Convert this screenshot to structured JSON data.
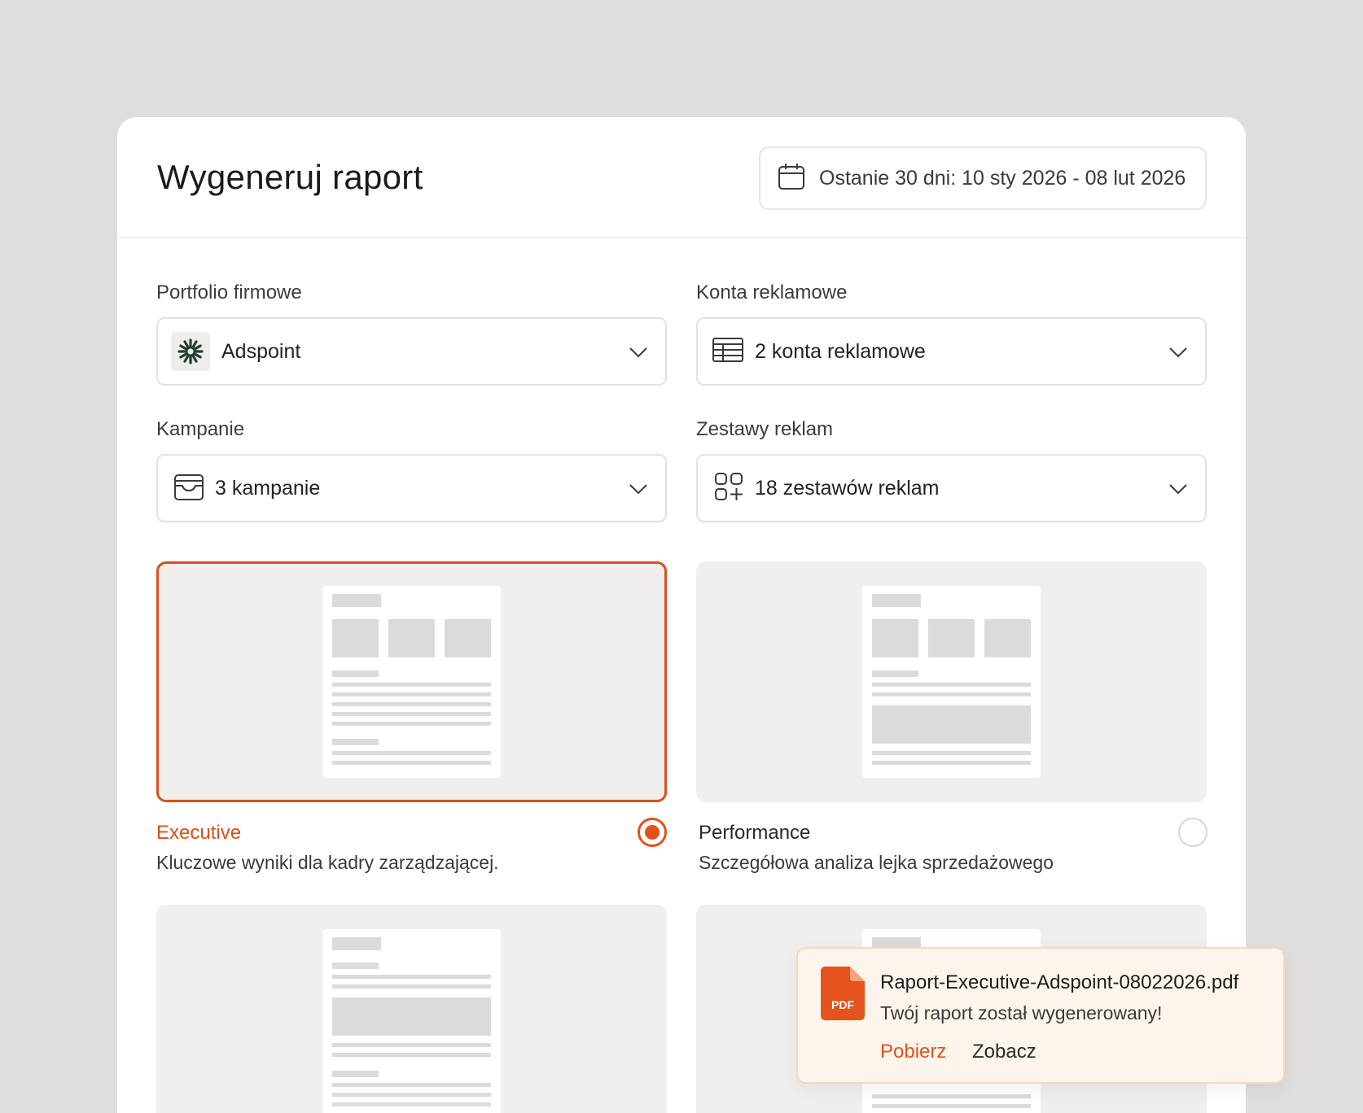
{
  "header": {
    "title": "Wygeneruj raport",
    "date_range": "Ostanie 30 dni: 10 sty 2026 - 08 lut 2026"
  },
  "filters": {
    "portfolio": {
      "label": "Portfolio firmowe",
      "value": "Adspoint"
    },
    "ad_accounts": {
      "label": "Konta reklamowe",
      "value": "2 konta reklamowe"
    },
    "campaigns": {
      "label": "Kampanie",
      "value": "3 kampanie"
    },
    "ad_sets": {
      "label": "Zestawy reklam",
      "value": "18 zestawów reklam"
    }
  },
  "templates": [
    {
      "title": "Executive",
      "description": "Kluczowe wyniki dla kadry zarządzającej.",
      "selected": true
    },
    {
      "title": "Performance",
      "description": "Szczegółowa analiza lejka sprzedażowego",
      "selected": false
    }
  ],
  "toast": {
    "badge": "PDF",
    "filename": "Raport-Executive-Adspoint-08022026.pdf",
    "message": "Twój raport został wygenerowany!",
    "download_label": "Pobierz",
    "view_label": "Zobacz"
  },
  "colors": {
    "accent": "#e0521b",
    "background": "#dfdedc",
    "card": "#ffffff",
    "template_bg": "#f0efed",
    "toast_bg": "#fdf5ec"
  },
  "icons": {
    "date_picker": "calendar-icon",
    "portfolio": "adspoint-logo",
    "ad_accounts": "table-icon",
    "campaigns": "inbox-icon",
    "ad_sets": "widgets-add-icon",
    "dropdown": "chevron-down-icon",
    "file": "pdf-file-icon"
  }
}
